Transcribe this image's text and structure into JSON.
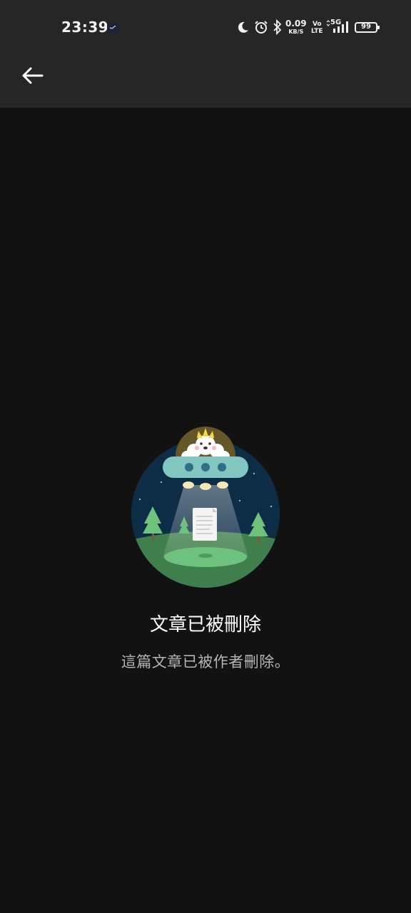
{
  "status_bar": {
    "time": "23:39",
    "net_speed_value": "0.09",
    "net_speed_unit": "KB/S",
    "volte_top": "Vo",
    "volte_bottom": "LTE",
    "network": "5G",
    "battery_level": "99",
    "icons": [
      "moon-icon",
      "alarm-icon",
      "bluetooth-icon",
      "signal-icon"
    ]
  },
  "header": {
    "back_icon": "arrow-left-icon"
  },
  "empty_state": {
    "title": "文章已被刪除",
    "message": "這篇文章已被作者刪除。",
    "illustration": "ufo-abducting-document"
  },
  "colors": {
    "background": "#121212",
    "bar": "#262626",
    "sky": "#0d2d47",
    "ground": "#3f7f4d",
    "ufo": "#82c6c1"
  }
}
